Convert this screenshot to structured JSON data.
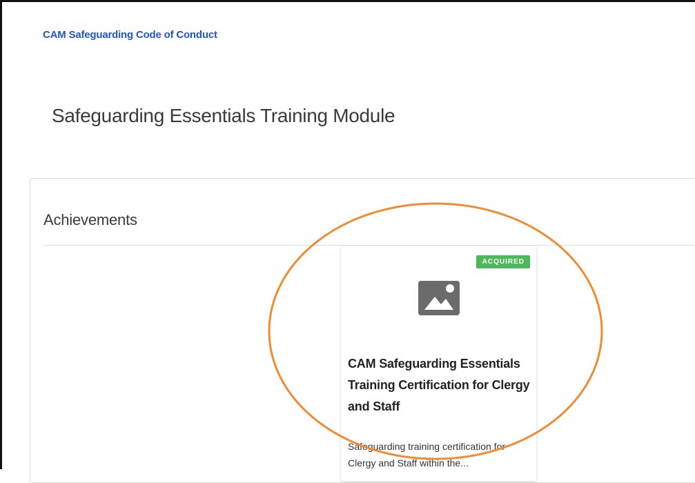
{
  "breadcrumb": {
    "link_label": "CAM Safeguarding Code of Conduct"
  },
  "page": {
    "title": "Safeguarding Essentials Training Module"
  },
  "achievements": {
    "section_title": "Achievements",
    "cards": [
      {
        "status": "ACQUIRED",
        "status_color": "#4cb85c",
        "icon": "image-placeholder-icon",
        "title": "CAM Safeguarding Essentials Training Certification for Clergy and Staff",
        "description": "Safeguarding training certification for Clergy and Staff within the..."
      }
    ]
  },
  "colors": {
    "link": "#1f55c8",
    "annotation": "#f28a30",
    "badge": "#4cb85c"
  }
}
